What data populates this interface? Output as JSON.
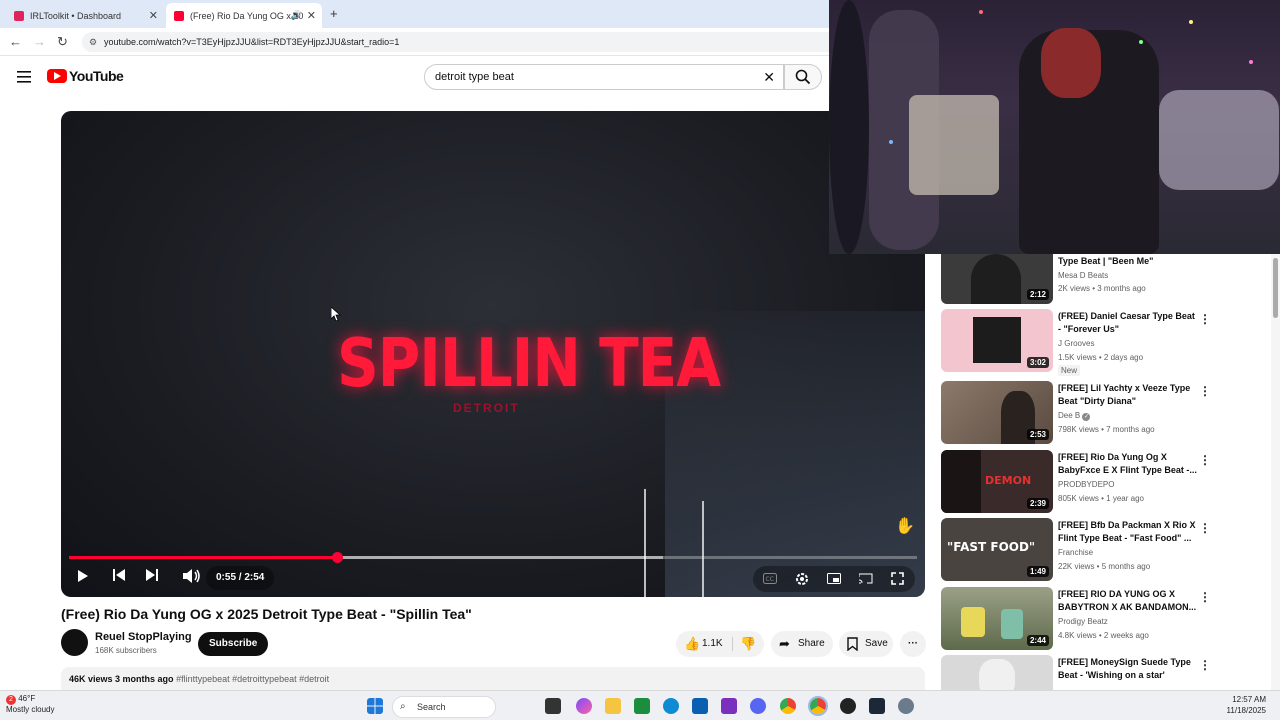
{
  "browser": {
    "tabs": [
      {
        "label": "IRLToolkit • Dashboard",
        "active": false
      },
      {
        "label": "(Free) Rio Da Yung OG x 20",
        "active": true
      }
    ],
    "new_tab": "+",
    "url": "youtube.com/watch?v=T3EyHjpzJJU&list=RDT3EyHjpzJJU&start_radio=1"
  },
  "youtube": {
    "logo_text": "YouTube",
    "search_value": "detroit type beat"
  },
  "player": {
    "art_title": "SPILLIN TEA",
    "art_subtitle": "DETROIT",
    "time": "0:55 / 2:54",
    "progress_fraction": 0.316,
    "buffered_fraction": 0.7
  },
  "video": {
    "title": "(Free) Rio Da Yung OG x 2025 Detroit Type Beat - \"Spillin Tea\"",
    "channel": "Reuel StopPlaying",
    "subscribers": "168K subscribers",
    "subscribe_label": "Subscribe",
    "likes": "1.1K",
    "share_label": "Share",
    "save_label": "Save",
    "views": "46K views",
    "age": "3 months ago",
    "tags": "#flinttypebeat #detroittypebeat #detroit"
  },
  "recommendations": [
    {
      "title": "Type Beat | \"Been Me\"",
      "channel": "Mesa D Beats",
      "meta": "2K views • 3 months ago",
      "duration": "2:12",
      "badge": "",
      "thumb_color": "#3b3b3b"
    },
    {
      "title": "(FREE) Daniel Caesar Type Beat - \"Forever Us\"",
      "channel": "J Grooves",
      "meta": "1.5K views • 2 days ago",
      "duration": "3:02",
      "badge": "New",
      "thumb_color": "#f3c6cf"
    },
    {
      "title": "[FREE] Lil Yachty x Veeze Type Beat \"Dirty Diana\"",
      "channel": "Dee B",
      "meta": "798K views • 7 months ago",
      "duration": "2:53",
      "badge": "",
      "thumb_color": "#6b5a4e"
    },
    {
      "title": "[FREE] Rio Da Yung Og X BabyFxce E X Flint Type Beat -...",
      "channel": "PRODBYDEPO",
      "meta": "805K views • 1 year ago",
      "duration": "2:39",
      "badge": "",
      "thumb_color": "#3a2a2a"
    },
    {
      "title": "[FREE] Bfb Da Packman X Rio X Flint Type Beat - \"Fast Food\" ...",
      "channel": "Franchise",
      "meta": "22K views • 5 months ago",
      "duration": "1:49",
      "badge": "",
      "thumb_color": "#4a4440"
    },
    {
      "title": "[FREE] RIO DA YUNG OG X BABYTRON X AK BANDAMON...",
      "channel": "Prodigy Beatz",
      "meta": "4.8K views • 2 weeks ago",
      "duration": "2:44",
      "badge": "",
      "thumb_color": "#6e7a5c"
    },
    {
      "title": "[FREE] MoneySign Suede Type Beat - 'Wishing on a star'",
      "channel": "",
      "meta": "",
      "duration": "",
      "badge": "",
      "thumb_color": "#d9d9d9"
    }
  ],
  "thumb_text": {
    "demon": "DEMON",
    "fast_food": "\"FAST FOOD\""
  },
  "taskbar": {
    "search": "Search",
    "weather_temp": "46°F",
    "weather_desc": "Mostly cloudy",
    "weather_badge": "2",
    "time": "12:57 AM",
    "date": "11/18/2025"
  }
}
